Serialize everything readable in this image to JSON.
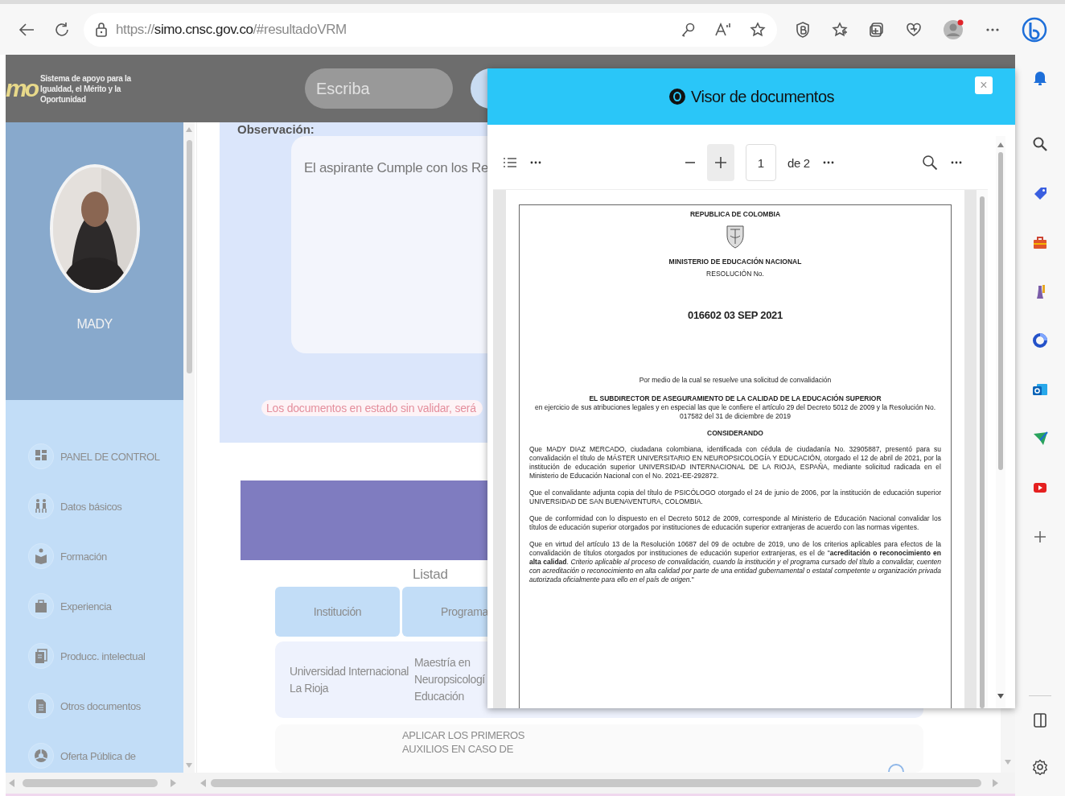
{
  "browser": {
    "url": "https://**simo.cnsc.gov.co**/#resultadoVRM"
  },
  "site_header": {
    "logo_mark": "mo",
    "logo_text": "Sistema de apoyo para la Igualdad, el Mérito y la Oportunidad",
    "search": {
      "placeholder": "Escriba"
    }
  },
  "profile": {
    "name": "MADY"
  },
  "nav": [
    {
      "label": "PANEL DE CONTROL"
    },
    {
      "label": "Datos básicos"
    },
    {
      "label": "Formación"
    },
    {
      "label": "Experiencia"
    },
    {
      "label": "Producc. intelectual"
    },
    {
      "label": "Otros documentos"
    },
    {
      "label": "Oferta Pública de"
    }
  ],
  "observation": {
    "label": "Observación:",
    "text": "El aspirante Cumple con los Re"
  },
  "notice": "Los documentos en estado sin validar, será",
  "listing_title": "Listad",
  "table": {
    "columns": [
      "Institución",
      "Programa"
    ],
    "rows": [
      [
        "Universidad Internacional La Rioja",
        "Maestría en Neuropsicologí Educación"
      ]
    ]
  },
  "next_row": "APLICAR LOS PRIMEROS AUXILIOS EN CASO DE",
  "viewer": {
    "title": "Visor de documentos",
    "close": "×",
    "page": "1",
    "page_count": "de 2",
    "document": {
      "country": "REPUBLICA DE COLOMBIA",
      "ministry": "MINISTERIO DE EDUCACIÓN NACIONAL",
      "resolution": "RESOLUCIÓN No.",
      "number": "016602 03 SEP 2021",
      "subject": "Por medio de la cual se resuelve una solicitud de convalidación",
      "authority": "EL SUBDIRECTOR DE ASEGURAMIENTO DE LA CALIDAD DE LA EDUCACIÓN SUPERIOR",
      "powers": "en ejercicio de sus atribuciones legales y en especial las que le confiere el artículo 29 del Decreto 5012 de 2009 y la Resolución No. 017582 del 31 de diciembre de 2019",
      "heading": "CONSIDERANDO",
      "paragraphs": [
        "Que MADY DIAZ MERCADO, ciudadana colombiana, identificada con cédula de ciudadanía No. 32905887, presentó para su convalidación el título de MÁSTER UNIVERSITARIO EN NEUROPSICOLOGÍA Y EDUCACIÓN, otorgado el 12 de abril de 2021, por la institución de educación superior UNIVERSIDAD INTERNACIONAL DE LA RIOJA, ESPAÑA, mediante solicitud radicada en el Ministerio de Educación Nacional con el No. 2021-EE-292872.",
        "Que el convalidante adjunta copia del título de PSICÓLOGO otorgado el 24 de junio de 2006, por la institución de educación superior UNIVERSIDAD DE SAN BUENAVENTURA, COLOMBIA.",
        "Que de conformidad con lo dispuesto en el Decreto 5012 de 2009, corresponde al Ministerio de Educación Nacional convalidar los títulos de educación superior otorgados por instituciones de educación superior extranjeras de acuerdo con las normas vigentes.",
        "Que en virtud del artículo 13 de la Resolución 10687 del 09 de octubre de 2019, uno de los criterios aplicables para efectos de la convalidación de títulos otorgados por instituciones de educación superior extranjeras, es el de \"**acreditación o reconocimiento en alta calidad**. *Criterio aplicable al proceso de convalidación, cuando la institución y el programa cursado del título a convalidar, cuenten con acreditación o reconocimiento en alta calidad por parte de una entidad gubernamental o estatal competente u organización privada autorizada oficialmente para ello en el país de origen.*\""
      ]
    }
  }
}
